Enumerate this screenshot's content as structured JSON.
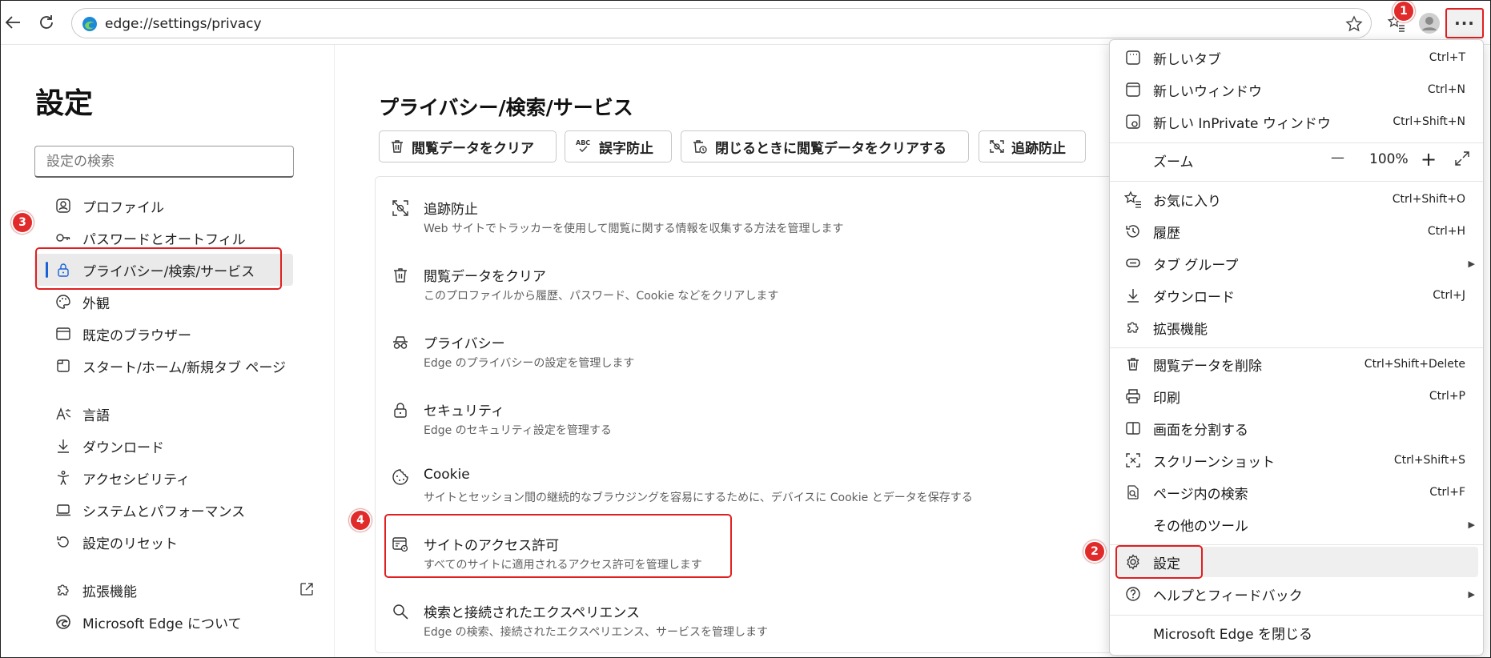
{
  "browser": {
    "url": "edge://settings/privacy"
  },
  "sidebar": {
    "title": "設定",
    "search_placeholder": "設定の検索",
    "items": [
      {
        "label": "プロファイル"
      },
      {
        "label": "パスワードとオートフィル"
      },
      {
        "label": "プライバシー/検索/サービス"
      },
      {
        "label": "外観"
      },
      {
        "label": "既定のブラウザー"
      },
      {
        "label": "スタート/ホーム/新規タブ ページ"
      },
      {
        "label": "言語"
      },
      {
        "label": "ダウンロード"
      },
      {
        "label": "アクセシビリティ"
      },
      {
        "label": "システムとパフォーマンス"
      },
      {
        "label": "設定のリセット"
      },
      {
        "label": "拡張機能"
      },
      {
        "label": "Microsoft Edge について"
      }
    ]
  },
  "main": {
    "title": "プライバシー/検索/サービス",
    "chips": [
      {
        "label": "閲覧データをクリア"
      },
      {
        "label": "誤字防止"
      },
      {
        "label": "閉じるときに閲覧データをクリアする"
      },
      {
        "label": "追跡防止"
      }
    ],
    "rows": [
      {
        "title": "追跡防止",
        "sub": "Web サイトでトラッカーを使用して閲覧に関する情報を収集する方法を管理します"
      },
      {
        "title": "閲覧データをクリア",
        "sub": "このプロファイルから履歴、パスワード、Cookie などをクリアします"
      },
      {
        "title": "プライバシー",
        "sub": "Edge のプライバシーの設定を管理します"
      },
      {
        "title": "セキュリティ",
        "sub": "Edge のセキュリティ設定を管理する"
      },
      {
        "title": "Cookie",
        "sub": "サイトとセッション間の継続的なブラウジングを容易にするために、デバイスに Cookie とデータを保存する"
      },
      {
        "title": "サイトのアクセス許可",
        "sub": "すべてのサイトに適用されるアクセス許可を管理します"
      },
      {
        "title": "検索と接続されたエクスペリエンス",
        "sub": "Edge の検索、接続されたエクスペリエンス、サービスを管理します"
      }
    ]
  },
  "menu": {
    "more_label": "···",
    "items": [
      {
        "label": "新しいタブ",
        "shortcut": "Ctrl+T"
      },
      {
        "label": "新しいウィンドウ",
        "shortcut": "Ctrl+N"
      },
      {
        "label": "新しい InPrivate ウィンドウ",
        "shortcut": "Ctrl+Shift+N"
      },
      {
        "label": "ズーム",
        "zoom": "100%",
        "minus": "—",
        "plus": "+"
      },
      {
        "label": "お気に入り",
        "shortcut": "Ctrl+Shift+O"
      },
      {
        "label": "履歴",
        "shortcut": "Ctrl+H"
      },
      {
        "label": "タブ グループ",
        "shortcut": "▶"
      },
      {
        "label": "ダウンロード",
        "shortcut": "Ctrl+J"
      },
      {
        "label": "拡張機能",
        "shortcut": ""
      },
      {
        "label": "閲覧データを削除",
        "shortcut": "Ctrl+Shift+Delete"
      },
      {
        "label": "印刷",
        "shortcut": "Ctrl+P"
      },
      {
        "label": "画面を分割する",
        "shortcut": ""
      },
      {
        "label": "スクリーンショット",
        "shortcut": "Ctrl+Shift+S"
      },
      {
        "label": "ページ内の検索",
        "shortcut": "Ctrl+F"
      },
      {
        "label": "その他のツール",
        "shortcut": "▶"
      },
      {
        "label": "設定",
        "shortcut": ""
      },
      {
        "label": "ヘルプとフィードバック",
        "shortcut": "▶"
      },
      {
        "label": "Microsoft Edge を閉じる",
        "shortcut": ""
      }
    ]
  },
  "annotations": {
    "badge1": "1",
    "badge2": "2",
    "badge3": "3",
    "badge4": "4"
  },
  "colors": {
    "annotation_red": "#e02020",
    "accent_blue": "#1a61d6"
  }
}
